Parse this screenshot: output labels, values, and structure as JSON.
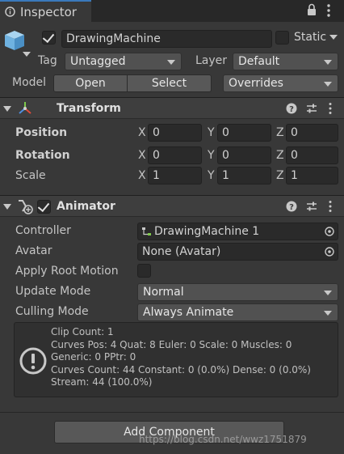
{
  "tab": {
    "title": "Inspector"
  },
  "gameobject": {
    "name": "DrawingMachine",
    "static_label": "Static",
    "tag_label": "Tag",
    "tag_value": "Untagged",
    "layer_label": "Layer",
    "layer_value": "Default",
    "model_label": "Model",
    "open_label": "Open",
    "select_label": "Select",
    "overrides_label": "Overrides"
  },
  "transform": {
    "title": "Transform",
    "rows": [
      {
        "label": "Position",
        "x": "0",
        "y": "0",
        "z": "0"
      },
      {
        "label": "Rotation",
        "x": "0",
        "y": "0",
        "z": "0"
      },
      {
        "label": "Scale",
        "x": "1",
        "y": "1",
        "z": "1"
      }
    ],
    "axis_x": "X",
    "axis_y": "Y",
    "axis_z": "Z"
  },
  "animator": {
    "title": "Animator",
    "controller_label": "Controller",
    "controller_value": "DrawingMachine 1",
    "avatar_label": "Avatar",
    "avatar_value": "None (Avatar)",
    "root_motion_label": "Apply Root Motion",
    "update_mode_label": "Update Mode",
    "update_mode_value": "Normal",
    "culling_mode_label": "Culling Mode",
    "culling_mode_value": "Always Animate",
    "info_lines": [
      "Clip Count: 1",
      "Curves Pos: 4 Quat: 8 Euler: 0 Scale: 0 Muscles: 0",
      "Generic: 0 PPtr: 0",
      "Curves Count: 44 Constant: 0 (0.0%) Dense: 0 (0.0%)",
      "Stream: 44 (100.0%)"
    ]
  },
  "add_component_label": "Add Component",
  "watermark": "https://blog.csdn.net/wwz1751879",
  "colors": {
    "accent": "#3a79bb",
    "background": "#383838",
    "field": "#2a2a2a"
  },
  "icons": [
    "inspector-icon",
    "lock-icon",
    "kebab-menu-icon",
    "gameobject-cube-icon",
    "transform-axes-icon",
    "animator-icon",
    "help-icon",
    "presets-icon",
    "object-picker-icon",
    "warning-icon"
  ]
}
